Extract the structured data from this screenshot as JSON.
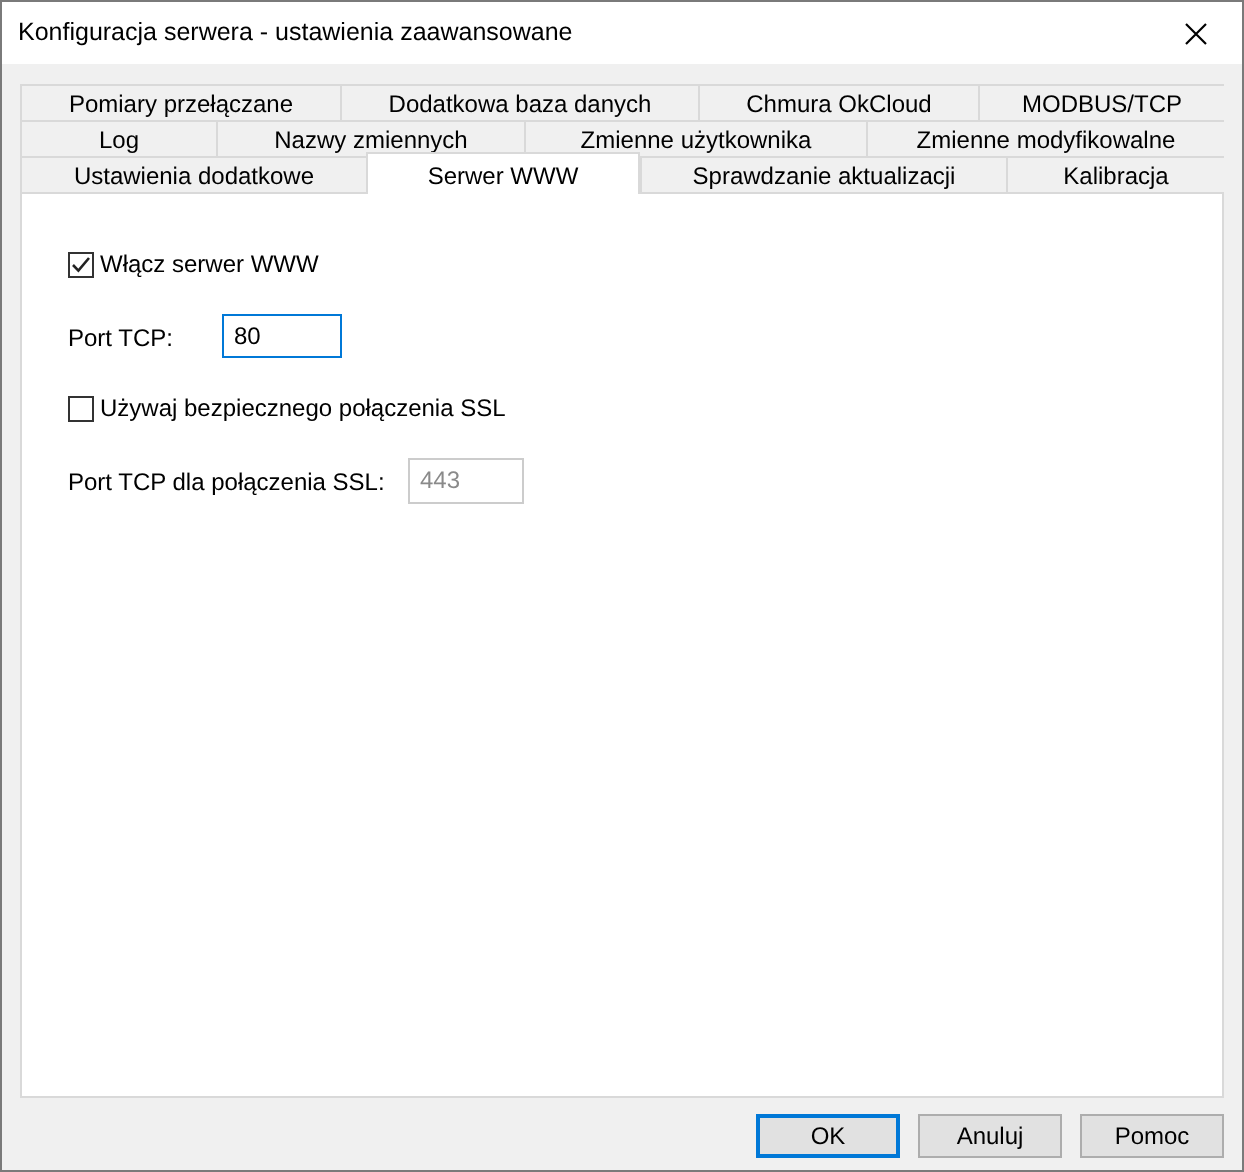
{
  "window": {
    "title": "Konfiguracja serwera - ustawienia zaawansowane"
  },
  "tab_rows": [
    [
      {
        "label": "Pomiary przełączane",
        "selected": false
      },
      {
        "label": "Dodatkowa baza danych",
        "selected": false
      },
      {
        "label": "Chmura OkCloud",
        "selected": false
      },
      {
        "label": "MODBUS/TCP",
        "selected": false
      }
    ],
    [
      {
        "label": "Log",
        "selected": false
      },
      {
        "label": "Nazwy zmiennych",
        "selected": false
      },
      {
        "label": "Zmienne użytkownika",
        "selected": false
      },
      {
        "label": "Zmienne modyfikowalne",
        "selected": false
      }
    ],
    [
      {
        "label": "Ustawienia dodatkowe",
        "selected": false
      },
      {
        "label": "Serwer WWW",
        "selected": true
      },
      {
        "label": "Sprawdzanie aktualizacji",
        "selected": false
      },
      {
        "label": "Kalibracja",
        "selected": false
      }
    ]
  ],
  "settings": [
    {
      "kind": "checkbox",
      "label": "Włącz serwer WWW",
      "checked": true
    },
    {
      "kind": "field",
      "label": "Port TCP:",
      "value": "80",
      "disabled": false,
      "focused": true
    },
    {
      "kind": "checkbox",
      "label": "Używaj bezpiecznego połączenia SSL",
      "checked": false
    },
    {
      "kind": "field",
      "label": "Port TCP dla połączenia SSL:",
      "value": "443",
      "disabled": true,
      "focused": false
    }
  ],
  "buttons": [
    {
      "label": "OK",
      "default": true
    },
    {
      "label": "Anuluj",
      "default": false
    },
    {
      "label": "Pomoc",
      "default": false
    }
  ]
}
